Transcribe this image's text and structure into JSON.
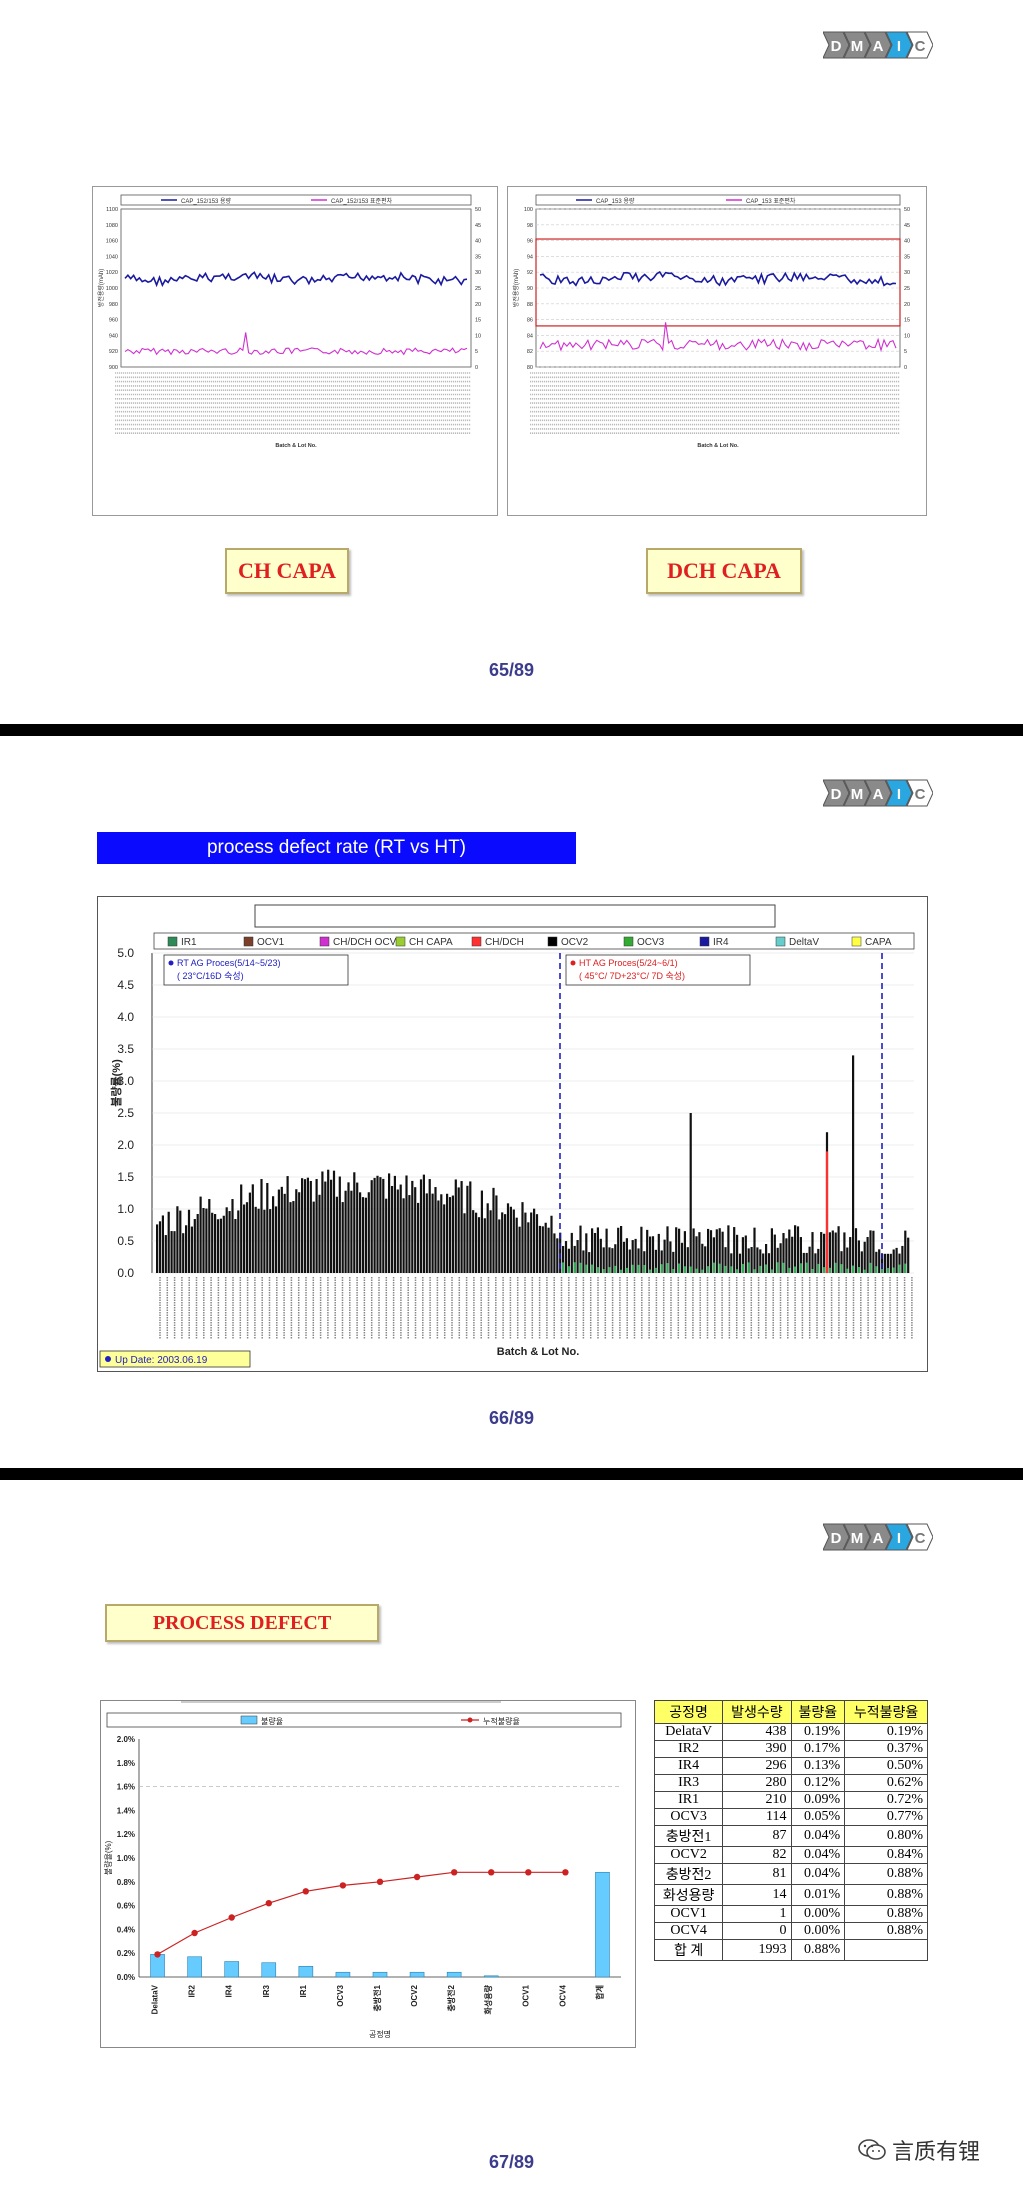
{
  "dmaic": {
    "letters": [
      "D",
      "M",
      "A",
      "I",
      "C"
    ],
    "active_index": 3,
    "active_color": "#2aa6e0",
    "inactive_color": "#8a8a8a"
  },
  "slide1": {
    "page": "65/89",
    "ch_label": "CH CAPA",
    "dch_label": "DCH CAPA",
    "ch_chart": {
      "legend": [
        "CAP_152/153 용량",
        "CAP_152/153 표준편차"
      ],
      "x_title": "Batch & Lot No.",
      "y_left_title": "방전용량(mAh)",
      "y_left_ticks": [
        "1100",
        "1080",
        "1060",
        "1040",
        "1020",
        "1000",
        "980",
        "960",
        "940",
        "920",
        "900"
      ],
      "y_right_ticks": [
        "50",
        "45",
        "40",
        "35",
        "30",
        "25",
        "20",
        "15",
        "10",
        "5",
        "0"
      ]
    },
    "dch_chart": {
      "legend": [
        "CAP_153 용량",
        "CAP_153 표준편차"
      ],
      "x_title": "Batch & Lot No.",
      "y_left_title": "방전용량(mAh)",
      "y_left_ticks": [
        "100",
        "98",
        "96",
        "94",
        "92",
        "90",
        "88",
        "86",
        "84",
        "82",
        "80"
      ],
      "y_right_ticks": [
        "50",
        "45",
        "40",
        "35",
        "30",
        "25",
        "20",
        "15",
        "10",
        "5",
        "0"
      ]
    }
  },
  "slide2": {
    "page": "66/89",
    "banner": "process defect rate (RT vs HT)",
    "legend": [
      {
        "label": "IR1",
        "color": "#2e8b57"
      },
      {
        "label": "OCV1",
        "color": "#7b3f2a"
      },
      {
        "label": "CH/DCH OCV",
        "color": "#d030d0"
      },
      {
        "label": "CH CAPA",
        "color": "#9acd32"
      },
      {
        "label": "CH/DCH",
        "color": "#ff3030"
      },
      {
        "label": "OCV2",
        "color": "#000000"
      },
      {
        "label": "OCV3",
        "color": "#33aa33"
      },
      {
        "label": "IR4",
        "color": "#1a1aa0"
      },
      {
        "label": "DeltaV",
        "color": "#66cccc"
      },
      {
        "label": "CAPA",
        "color": "#ffff44"
      }
    ],
    "y_title": "불량률(%)",
    "y_ticks": [
      "5.0",
      "4.5",
      "4.0",
      "3.5",
      "3.0",
      "2.5",
      "2.0",
      "1.5",
      "1.0",
      "0.5",
      "0.0"
    ],
    "x_title": "Batch & Lot No.",
    "rt_note": "RT AG Proces(5/14~5/23)",
    "rt_note2": "( 23°C/16D 숙성)",
    "ht_note": "HT AG Proces(5/24~6/1)",
    "ht_note2": "( 45°C/ 7D+23°C/ 7D 숙성)",
    "update": "Up Date: 2003.06.19"
  },
  "slide3": {
    "page": "67/89",
    "label": "PROCESS DEFECT",
    "legend_bar": "불량율",
    "legend_line": "누적불량율",
    "x_title": "공정명",
    "y_title": "불량율(%)",
    "chart_data": {
      "type": "bar",
      "categories": [
        "DelataV",
        "IR2",
        "IR4",
        "IR3",
        "IR1",
        "OCV3",
        "충방전1",
        "OCV2",
        "충방전2",
        "화성용량",
        "OCV1",
        "OCV4",
        "합계"
      ],
      "series": [
        {
          "name": "불량율",
          "values": [
            0.19,
            0.17,
            0.13,
            0.12,
            0.09,
            0.04,
            0.04,
            0.04,
            0.04,
            0.01,
            0.0,
            0.0,
            0.88
          ]
        },
        {
          "name": "누적불량율",
          "values": [
            0.19,
            0.37,
            0.5,
            0.62,
            0.72,
            0.77,
            0.8,
            0.84,
            0.88,
            0.88,
            0.88,
            0.88
          ]
        }
      ],
      "ylim": [
        0,
        2.0
      ],
      "y_ticks": [
        "2.0%",
        "1.8%",
        "1.6%",
        "1.4%",
        "1.2%",
        "1.0%",
        "0.8%",
        "0.6%",
        "0.4%",
        "0.2%",
        "0.0%"
      ]
    },
    "table": {
      "headers": [
        "공정명",
        "발생수량",
        "불량율",
        "누적불량율"
      ],
      "rows": [
        [
          "DelataV",
          "438",
          "0.19%",
          "0.19%"
        ],
        [
          "IR2",
          "390",
          "0.17%",
          "0.37%"
        ],
        [
          "IR4",
          "296",
          "0.13%",
          "0.50%"
        ],
        [
          "IR3",
          "280",
          "0.12%",
          "0.62%"
        ],
        [
          "IR1",
          "210",
          "0.09%",
          "0.72%"
        ],
        [
          "OCV3",
          "114",
          "0.05%",
          "0.77%"
        ],
        [
          "충방전1",
          "87",
          "0.04%",
          "0.80%"
        ],
        [
          "OCV2",
          "82",
          "0.04%",
          "0.84%"
        ],
        [
          "충방전2",
          "81",
          "0.04%",
          "0.88%"
        ],
        [
          "화성용량",
          "14",
          "0.01%",
          "0.88%"
        ],
        [
          "OCV1",
          "1",
          "0.00%",
          "0.88%"
        ],
        [
          "OCV4",
          "0",
          "0.00%",
          "0.88%"
        ],
        [
          "합 계",
          "1993",
          "0.88%",
          ""
        ]
      ]
    },
    "watermark": "言质有锂"
  }
}
